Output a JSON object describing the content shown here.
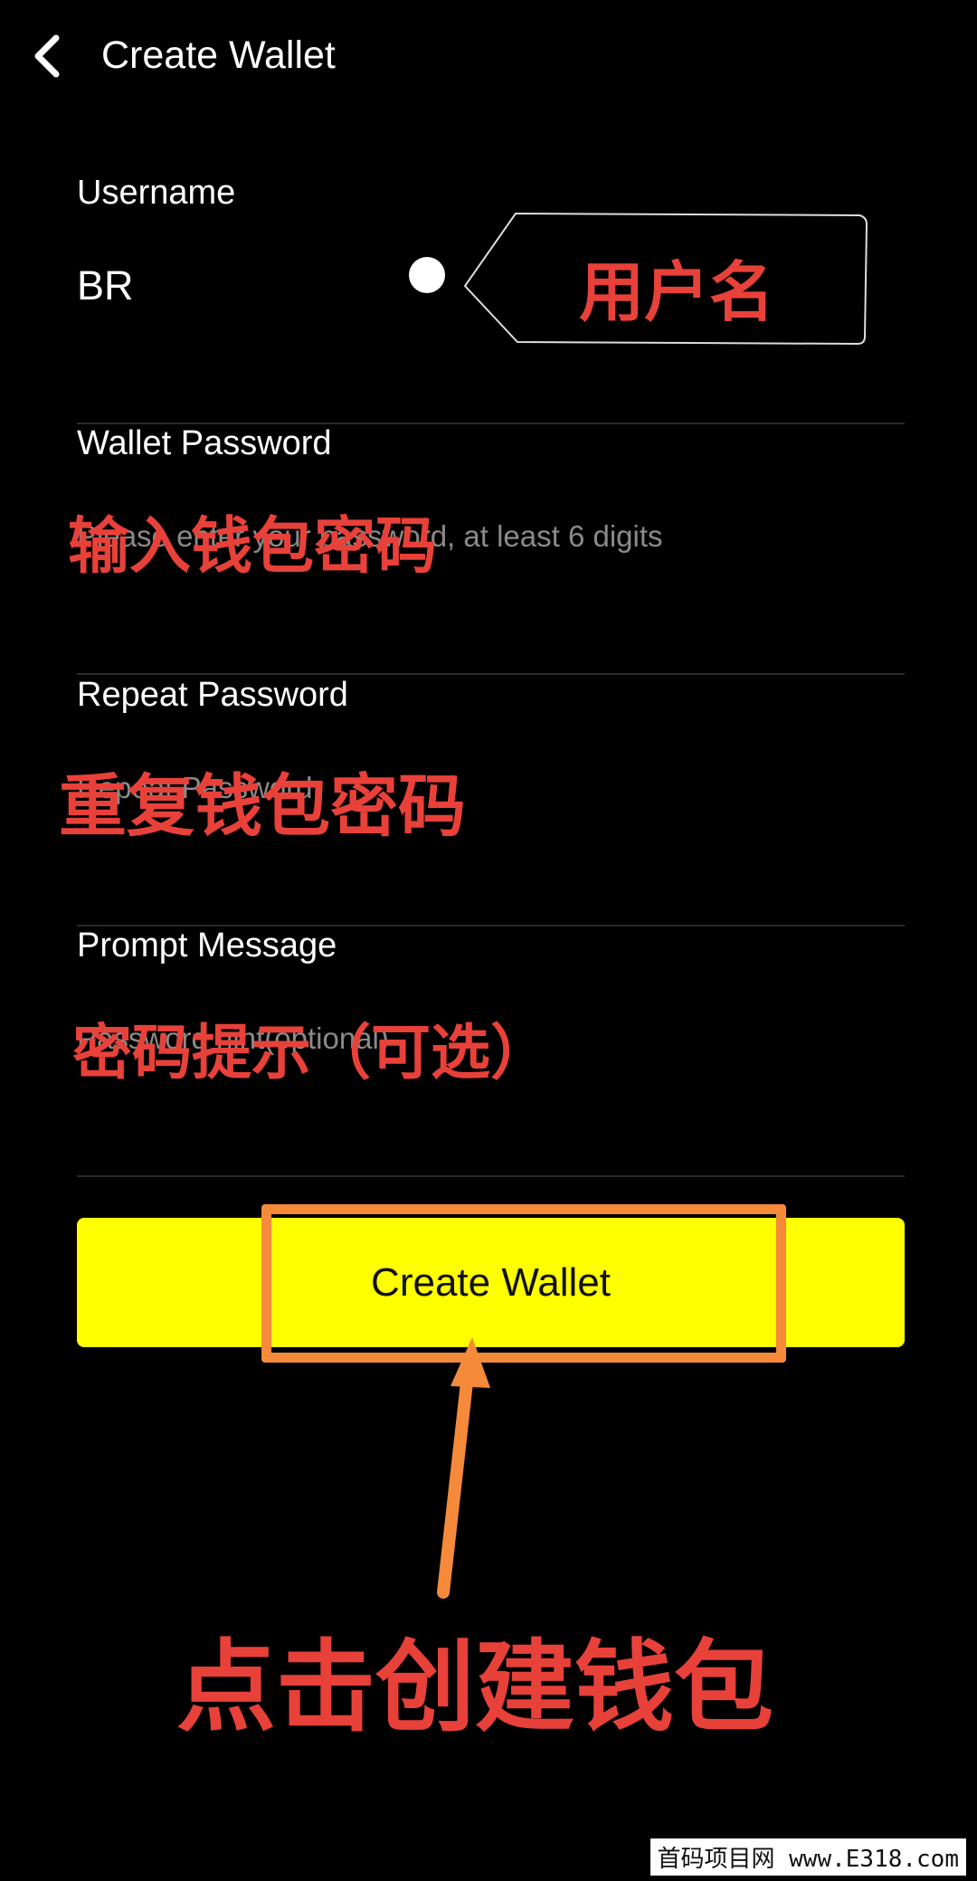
{
  "header": {
    "title": "Create Wallet"
  },
  "form": {
    "username": {
      "label": "Username",
      "value": "BR"
    },
    "wallet_password": {
      "label": "Wallet Password",
      "placeholder": "Please enter your password, at least 6 digits"
    },
    "repeat_password": {
      "label": "Repeat Password",
      "placeholder": "Repeat Password"
    },
    "prompt_message": {
      "label": "Prompt Message",
      "placeholder": "Password hint(optional)"
    }
  },
  "create_button": {
    "label": "Create Wallet"
  },
  "annotations": {
    "username_note": "用户名",
    "password_note": "输入钱包密码",
    "repeat_note": "重复钱包密码",
    "hint_note": "密码提示（可选）",
    "button_note": "点击创建钱包",
    "highlight_color": "#f58a3a",
    "text_color": "#e8413a"
  },
  "watermark": "首码项目网 www.E318.com"
}
